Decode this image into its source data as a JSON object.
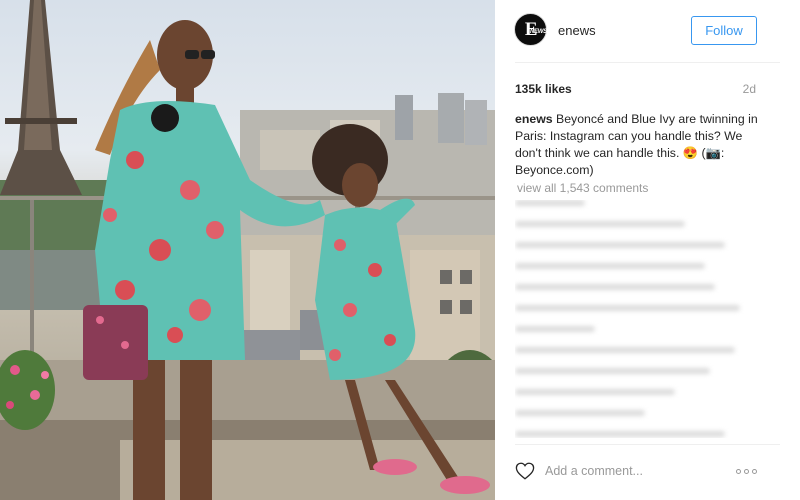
{
  "post": {
    "photo": {
      "description_icon": "photo-image"
    },
    "header": {
      "account_name": "enews",
      "avatar_letter": "E",
      "avatar_small": "NEWS",
      "follow_label": "Follow"
    },
    "stats": {
      "likes": "135k likes",
      "time_ago": "2d"
    },
    "caption": {
      "author": "enews",
      "text": "Beyoncé and Blue Ivy are twinning in Paris: Instagram can you handle this? We don't think we can handle this. 😍 (📷: Beyonce.com)"
    },
    "view_all_comments": "view all 1,543 comments",
    "footer": {
      "add_comment_placeholder": "Add a comment...",
      "more_icon": "more-options-icon",
      "like_icon": "heart-icon"
    }
  },
  "colors": {
    "follow_blue": "#3897f0",
    "text_dark": "#262626",
    "text_muted": "#999999",
    "divider": "#efefef"
  }
}
